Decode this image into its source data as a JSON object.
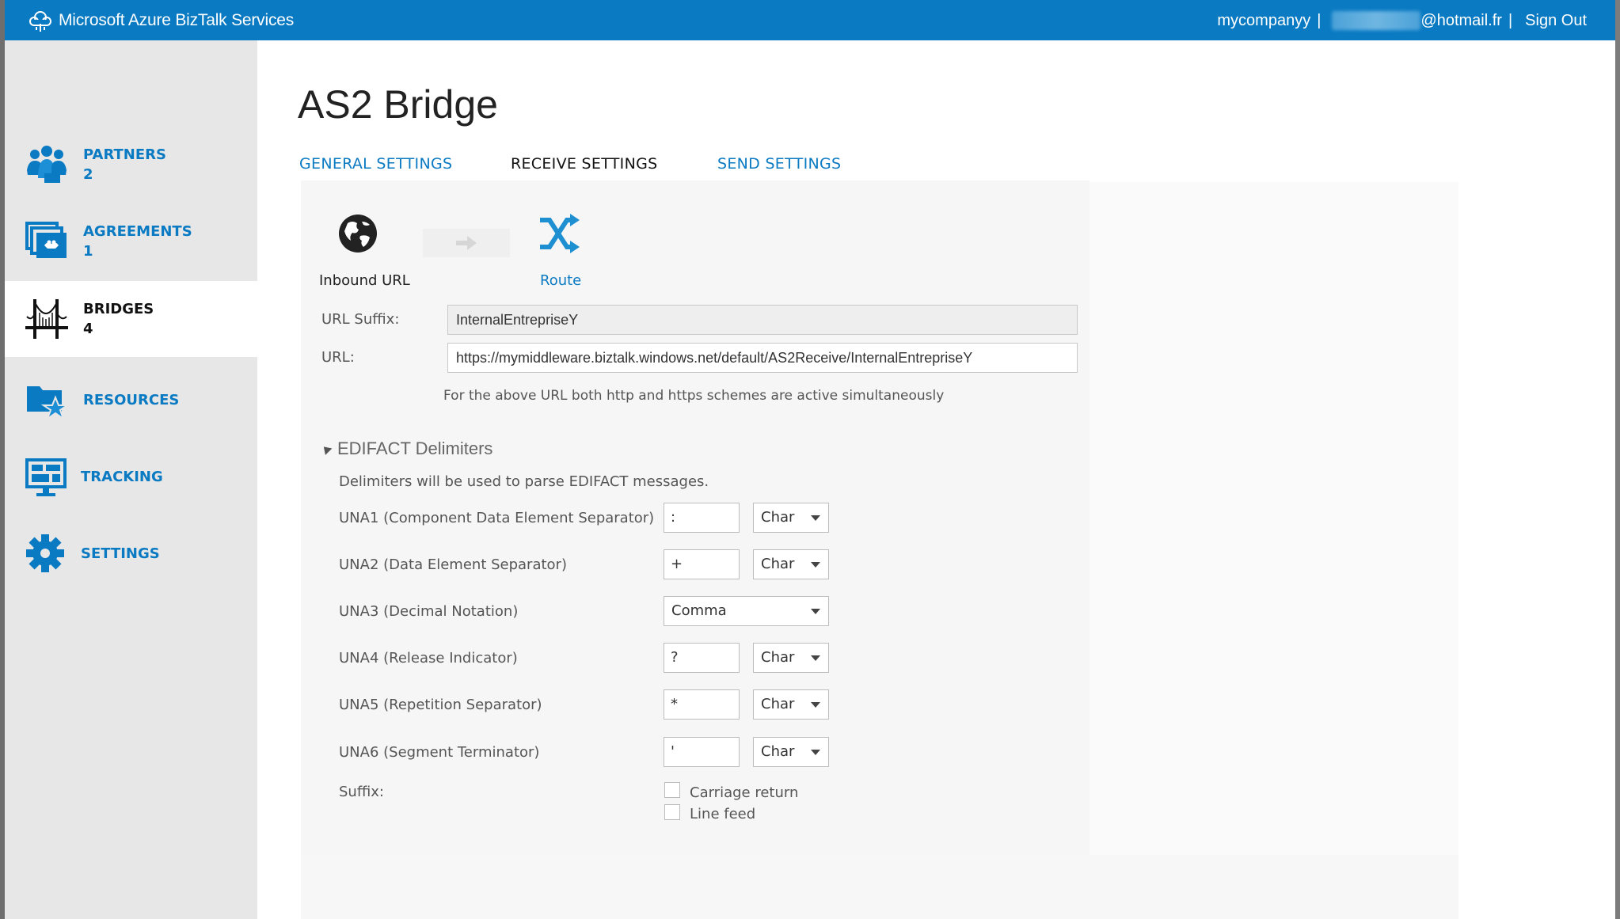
{
  "header": {
    "app_title": "Microsoft Azure BizTalk Services",
    "company": "mycompanyy",
    "separator": "|",
    "email_domain": "@hotmail.fr",
    "sign_out": "Sign Out"
  },
  "sidebar": {
    "items": [
      {
        "label": "PARTNERS",
        "count": "2",
        "icon": "partners-icon"
      },
      {
        "label": "AGREEMENTS",
        "count": "1",
        "icon": "agreements-icon"
      },
      {
        "label": "BRIDGES",
        "count": "4",
        "icon": "bridge-icon",
        "active": true
      },
      {
        "label": "RESOURCES",
        "count": "",
        "icon": "resources-icon"
      },
      {
        "label": "TRACKING",
        "count": "",
        "icon": "tracking-icon"
      },
      {
        "label": "SETTINGS",
        "count": "",
        "icon": "gear-icon"
      }
    ]
  },
  "page": {
    "title": "AS2 Bridge",
    "tabs": [
      {
        "label": "GENERAL SETTINGS",
        "active": false
      },
      {
        "label": "RECEIVE SETTINGS",
        "active": true
      },
      {
        "label": "SEND SETTINGS",
        "active": false
      }
    ]
  },
  "flow": {
    "inbound_label": "Inbound URL",
    "route_label": "Route"
  },
  "receive": {
    "url_suffix_label": "URL Suffix:",
    "url_suffix_value": "InternalEntrepriseY",
    "url_label": "URL:",
    "url_value": "https://mymiddleware.biztalk.windows.net/default/AS2Receive/InternalEntrepriseY",
    "url_note": "For the above URL both http and https schemes are active simultaneously"
  },
  "edifact": {
    "section_title": "EDIFACT Delimiters",
    "description": "Delimiters will be used to parse EDIFACT messages.",
    "rows": [
      {
        "label": "UNA1 (Component Data Element Separator)",
        "value": ":",
        "type": "Char"
      },
      {
        "label": "UNA2 (Data Element Separator)",
        "value": "+",
        "type": "Char"
      },
      {
        "label": "UNA3 (Decimal Notation)",
        "value": "Comma"
      },
      {
        "label": "UNA4 (Release Indicator)",
        "value": "?",
        "type": "Char"
      },
      {
        "label": "UNA5 (Repetition Separator)",
        "value": "*",
        "type": "Char"
      },
      {
        "label": "UNA6 (Segment Terminator)",
        "value": "'",
        "type": "Char"
      }
    ],
    "suffix_label": "Suffix:",
    "suffix_options": [
      {
        "label": "Carriage return",
        "checked": false
      },
      {
        "label": "Line feed",
        "checked": false
      }
    ]
  },
  "colors": {
    "accent": "#0a7ac2",
    "sidebar_bg": "#e7e7e7",
    "panel_bg": "#f6f6f6"
  }
}
